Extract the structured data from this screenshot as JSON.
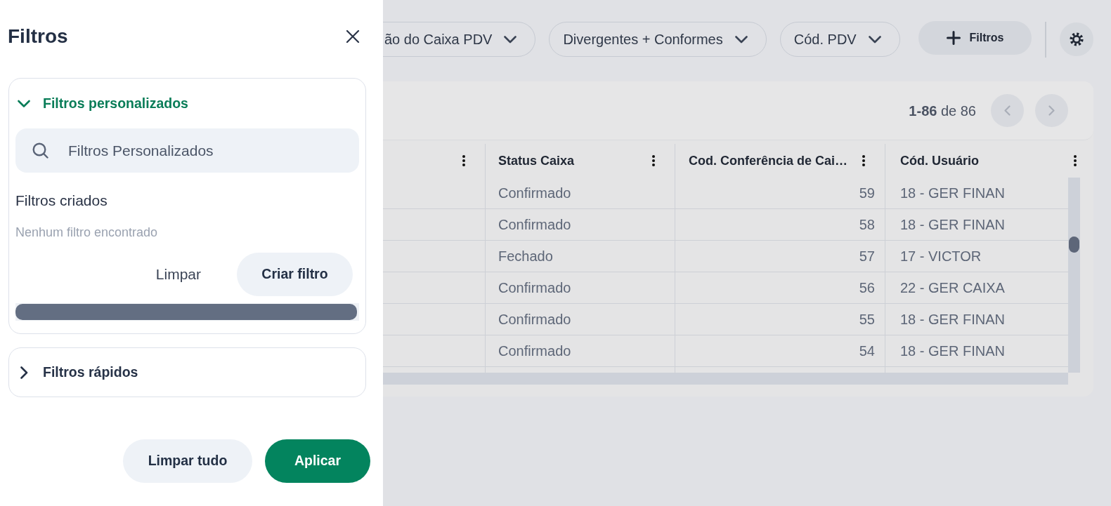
{
  "drawer": {
    "title": "Filtros",
    "sections": [
      {
        "title": "Filtros personalizados",
        "expanded": true,
        "search": {
          "placeholder": "Filtros Personalizados"
        },
        "subtitle": "Filtros criados",
        "empty_message": "Nenhum filtro encontrado",
        "buttons": [
          {
            "label": "Limpar",
            "kind": "plain"
          },
          {
            "label": "Criar filtro",
            "kind": "soft"
          }
        ]
      },
      {
        "title": "Filtros rápidos",
        "expanded": false
      }
    ],
    "footer_buttons": [
      {
        "label": "Limpar tudo",
        "kind": "soft"
      },
      {
        "label": "Aplicar",
        "kind": "primary"
      }
    ]
  },
  "toolbar": {
    "filter_chips": [
      {
        "label": "ão do Caixa PDV",
        "cut_off": true
      },
      {
        "label": "Divergentes + Conformes",
        "cut_off": false
      },
      {
        "label": "Cód. PDV",
        "cut_off": false
      }
    ],
    "add_filter_button": "Filtros"
  },
  "table": {
    "pagination": "**1-86** de 86",
    "columns": [
      {
        "label": "Status Caixa",
        "kind": "text"
      },
      {
        "label": "Cod. Conferência de Cai…",
        "kind": "number"
      },
      {
        "label": "Cód. Usuário",
        "kind": "text"
      }
    ],
    "rows": [
      [
        "Confirmado",
        "59",
        "18 - GER FINAN"
      ],
      [
        "Confirmado",
        "58",
        "18 - GER FINAN"
      ],
      [
        "Fechado",
        "57",
        "17 - VICTOR"
      ],
      [
        "Confirmado",
        "56",
        "22 - GER CAIXA"
      ],
      [
        "Confirmado",
        "55",
        "18 - GER FINAN"
      ],
      [
        "Confirmado",
        "54",
        "18 - GER FINAN"
      ]
    ]
  }
}
